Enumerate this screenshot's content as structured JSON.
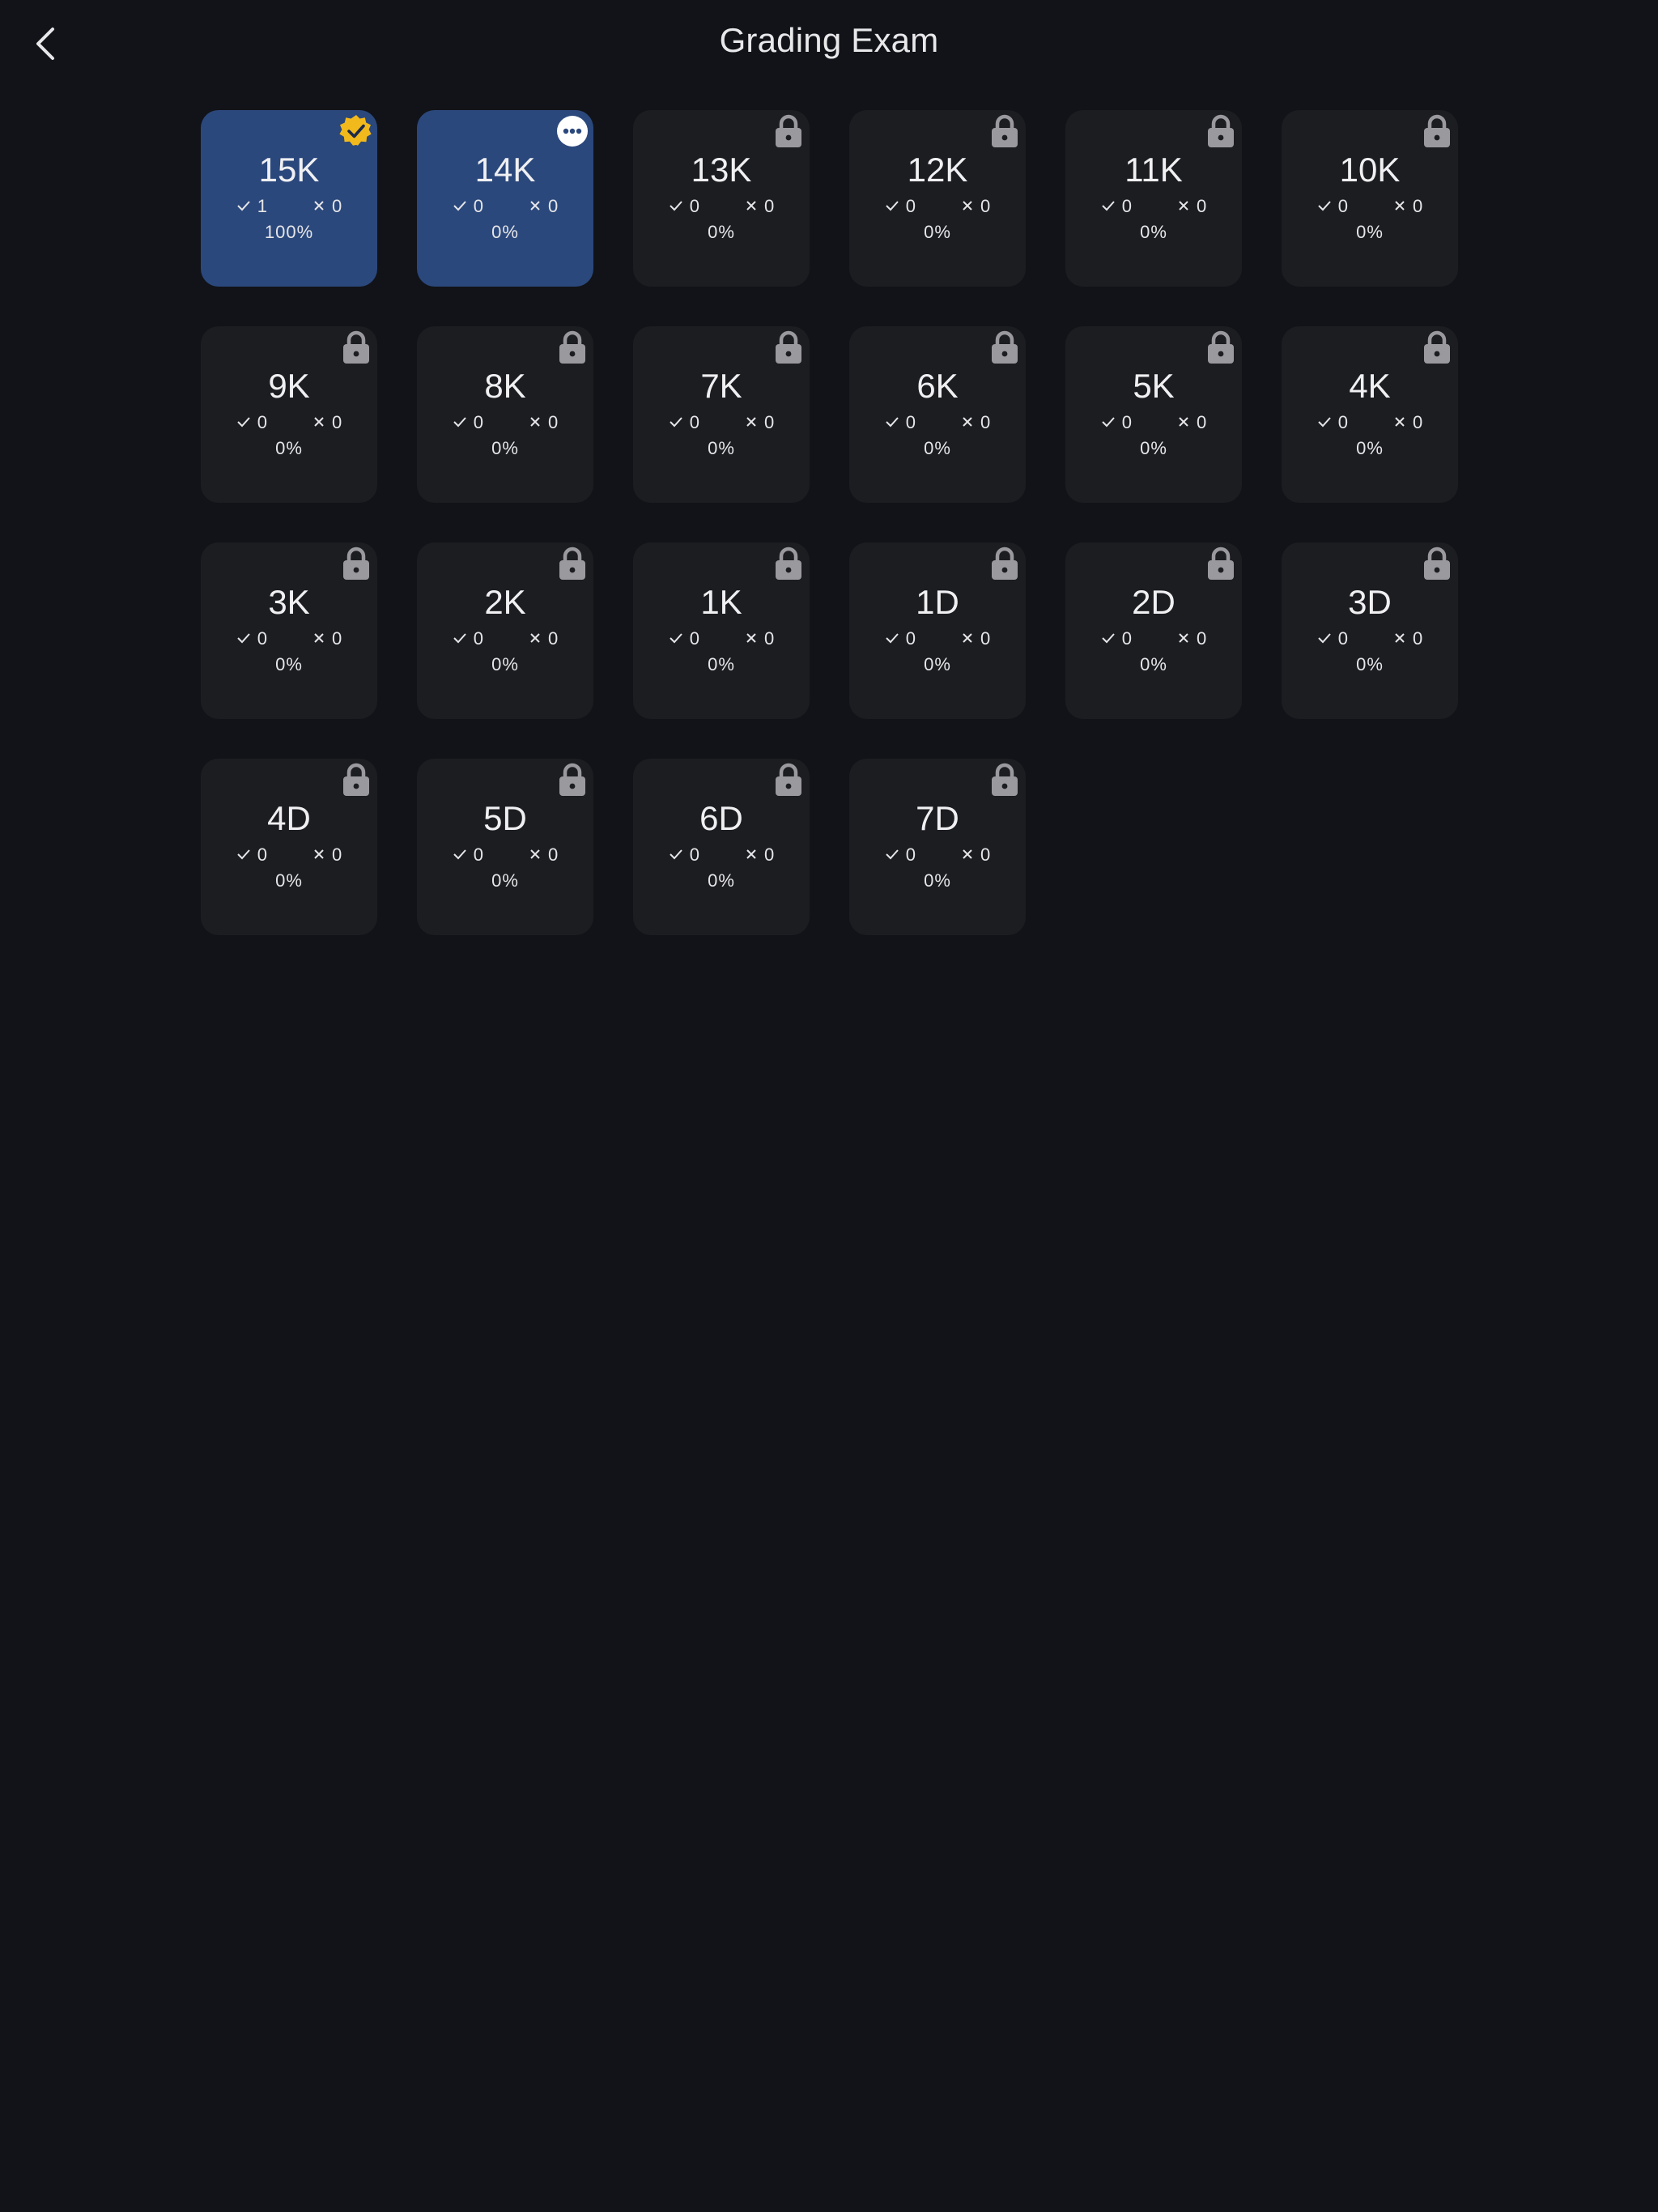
{
  "header": {
    "title": "Grading Exam"
  },
  "colors": {
    "background": "#111318",
    "card": "#1c1d21",
    "active_card": "#2b487c",
    "badge_gold": "#f2b91c",
    "lock_gray": "#9a9a9e"
  },
  "levels": [
    {
      "rank": "15K",
      "correct": "1",
      "wrong": "0",
      "percent": "100%",
      "state": "completed"
    },
    {
      "rank": "14K",
      "correct": "0",
      "wrong": "0",
      "percent": "0%",
      "state": "in-progress"
    },
    {
      "rank": "13K",
      "correct": "0",
      "wrong": "0",
      "percent": "0%",
      "state": "locked"
    },
    {
      "rank": "12K",
      "correct": "0",
      "wrong": "0",
      "percent": "0%",
      "state": "locked"
    },
    {
      "rank": "11K",
      "correct": "0",
      "wrong": "0",
      "percent": "0%",
      "state": "locked"
    },
    {
      "rank": "10K",
      "correct": "0",
      "wrong": "0",
      "percent": "0%",
      "state": "locked"
    },
    {
      "rank": "9K",
      "correct": "0",
      "wrong": "0",
      "percent": "0%",
      "state": "locked"
    },
    {
      "rank": "8K",
      "correct": "0",
      "wrong": "0",
      "percent": "0%",
      "state": "locked"
    },
    {
      "rank": "7K",
      "correct": "0",
      "wrong": "0",
      "percent": "0%",
      "state": "locked"
    },
    {
      "rank": "6K",
      "correct": "0",
      "wrong": "0",
      "percent": "0%",
      "state": "locked"
    },
    {
      "rank": "5K",
      "correct": "0",
      "wrong": "0",
      "percent": "0%",
      "state": "locked"
    },
    {
      "rank": "4K",
      "correct": "0",
      "wrong": "0",
      "percent": "0%",
      "state": "locked"
    },
    {
      "rank": "3K",
      "correct": "0",
      "wrong": "0",
      "percent": "0%",
      "state": "locked"
    },
    {
      "rank": "2K",
      "correct": "0",
      "wrong": "0",
      "percent": "0%",
      "state": "locked"
    },
    {
      "rank": "1K",
      "correct": "0",
      "wrong": "0",
      "percent": "0%",
      "state": "locked"
    },
    {
      "rank": "1D",
      "correct": "0",
      "wrong": "0",
      "percent": "0%",
      "state": "locked"
    },
    {
      "rank": "2D",
      "correct": "0",
      "wrong": "0",
      "percent": "0%",
      "state": "locked"
    },
    {
      "rank": "3D",
      "correct": "0",
      "wrong": "0",
      "percent": "0%",
      "state": "locked"
    },
    {
      "rank": "4D",
      "correct": "0",
      "wrong": "0",
      "percent": "0%",
      "state": "locked"
    },
    {
      "rank": "5D",
      "correct": "0",
      "wrong": "0",
      "percent": "0%",
      "state": "locked"
    },
    {
      "rank": "6D",
      "correct": "0",
      "wrong": "0",
      "percent": "0%",
      "state": "locked"
    },
    {
      "rank": "7D",
      "correct": "0",
      "wrong": "0",
      "percent": "0%",
      "state": "locked"
    }
  ]
}
